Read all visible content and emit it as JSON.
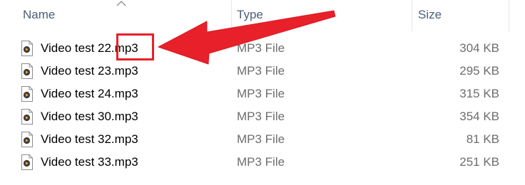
{
  "columns": {
    "name": "Name",
    "type": "Type",
    "size": "Size"
  },
  "sort": {
    "column": "name",
    "direction": "ascending",
    "icon": "chevron-up-icon"
  },
  "files": [
    {
      "name": "Video test 22.mp3",
      "type": "MP3 File",
      "size": "304 KB",
      "icon": "audio-file-icon"
    },
    {
      "name": "Video test 23.mp3",
      "type": "MP3 File",
      "size": "295 KB",
      "icon": "audio-file-icon"
    },
    {
      "name": "Video test 24.mp3",
      "type": "MP3 File",
      "size": "315 KB",
      "icon": "audio-file-icon"
    },
    {
      "name": "Video test 30.mp3",
      "type": "MP3 File",
      "size": "354 KB",
      "icon": "audio-file-icon"
    },
    {
      "name": "Video test 32.mp3",
      "type": "MP3 File",
      "size": "81 KB",
      "icon": "audio-file-icon"
    },
    {
      "name": "Video test 33.mp3",
      "type": "MP3 File",
      "size": "251 KB",
      "icon": "audio-file-icon"
    }
  ],
  "annotation": {
    "target": "extension of Video test 22.mp3",
    "color": "#e8202a"
  }
}
